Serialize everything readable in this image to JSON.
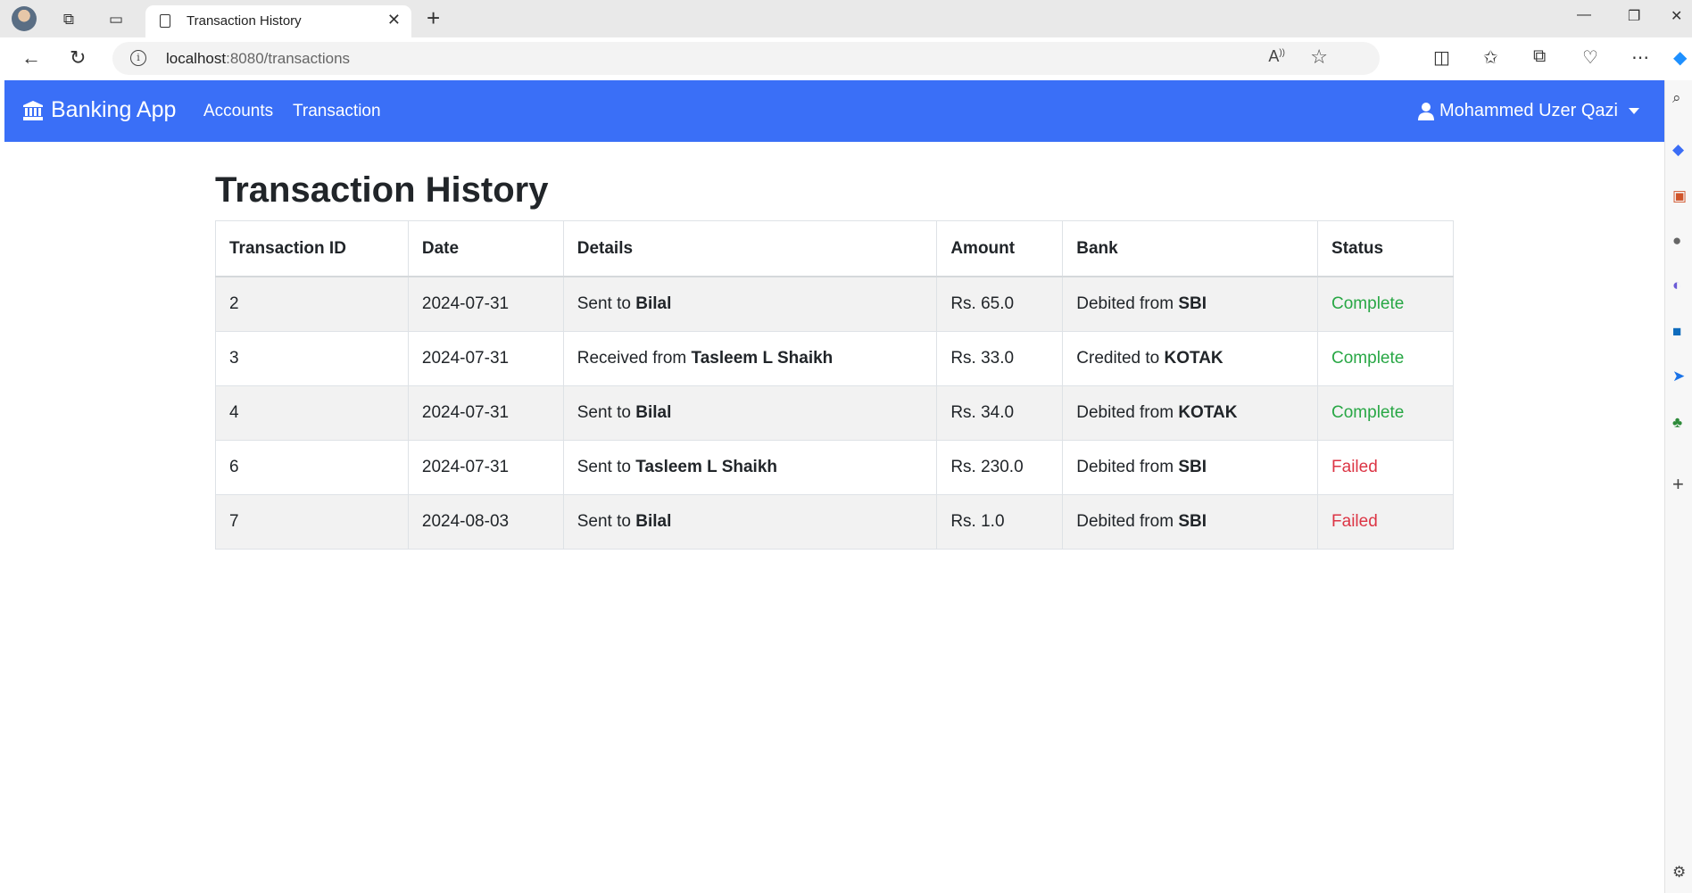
{
  "browser": {
    "tab_title": "Transaction History",
    "url_host": "localhost",
    "url_path": ":8080/transactions"
  },
  "navbar": {
    "brand": "Banking App",
    "links": [
      "Accounts",
      "Transaction"
    ],
    "user_name": "Mohammed Uzer Qazi"
  },
  "page": {
    "title": "Transaction History"
  },
  "table": {
    "headers": [
      "Transaction ID",
      "Date",
      "Details",
      "Amount",
      "Bank",
      "Status"
    ],
    "rows": [
      {
        "id": "2",
        "date": "2024-07-31",
        "details_prefix": "Sent to",
        "details_name": "Bilal",
        "amount": "Rs. 65.0",
        "bank_prefix": "Debited from",
        "bank_name": "SBI",
        "status": "Complete"
      },
      {
        "id": "3",
        "date": "2024-07-31",
        "details_prefix": "Received from",
        "details_name": "Tasleem L Shaikh",
        "amount": "Rs. 33.0",
        "bank_prefix": "Credited to",
        "bank_name": "KOTAK",
        "status": "Complete"
      },
      {
        "id": "4",
        "date": "2024-07-31",
        "details_prefix": "Sent to",
        "details_name": "Bilal",
        "amount": "Rs. 34.0",
        "bank_prefix": "Debited from",
        "bank_name": "KOTAK",
        "status": "Complete"
      },
      {
        "id": "6",
        "date": "2024-07-31",
        "details_prefix": "Sent to",
        "details_name": "Tasleem L Shaikh",
        "amount": "Rs. 230.0",
        "bank_prefix": "Debited from",
        "bank_name": "SBI",
        "status": "Failed"
      },
      {
        "id": "7",
        "date": "2024-08-03",
        "details_prefix": "Sent to",
        "details_name": "Bilal",
        "amount": "Rs. 1.0",
        "bank_prefix": "Debited from",
        "bank_name": "SBI",
        "status": "Failed"
      }
    ]
  },
  "colors": {
    "navbar_bg": "#3a6ff7",
    "status_complete": "#28a745",
    "status_failed": "#dc3545"
  }
}
